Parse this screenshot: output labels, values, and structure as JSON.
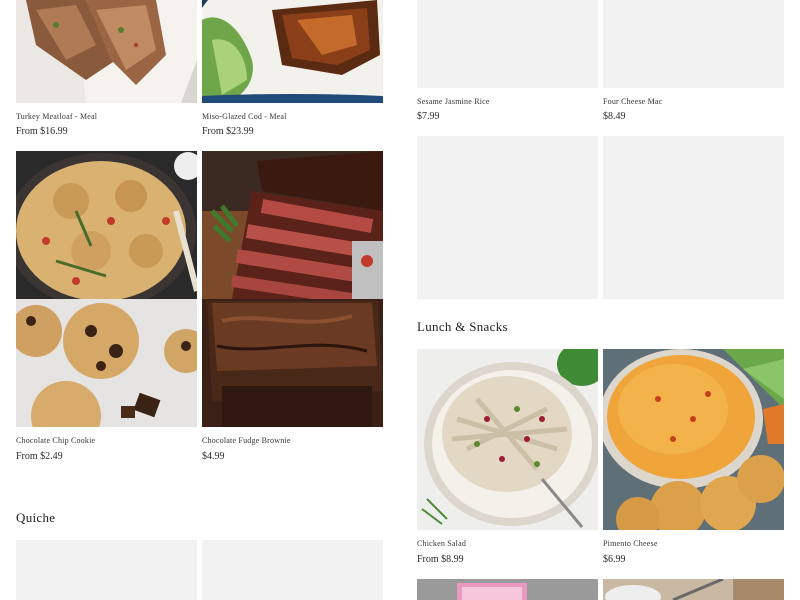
{
  "left_column": {
    "row1": [
      {
        "name": "Turkey Meatloaf - Meal",
        "price": "From $16.99",
        "image_icon": "turkey-meatloaf-image"
      },
      {
        "name": "Miso-Glazed Cod - Meal",
        "price": "From $23.99",
        "image_icon": "miso-glazed-cod-image"
      }
    ],
    "row2": [
      {
        "name": "Chocolate Chip Cookie",
        "price": "From $2.49",
        "image_icon": "chocolate-chip-cookie-image"
      },
      {
        "name": "Chocolate Fudge Brownie",
        "price": "$4.99",
        "image_icon": "chocolate-fudge-brownie-image"
      }
    ],
    "quiche_section": {
      "title": "Quiche"
    }
  },
  "right_column": {
    "row1": [
      {
        "name": "Sesame Jasmine Rice",
        "price": "$7.99"
      },
      {
        "name": "Four Cheese Mac",
        "price": "$8.49"
      }
    ],
    "lunch_section": {
      "title": "Lunch & Snacks"
    },
    "lunch_row": [
      {
        "name": "Chicken Salad",
        "price": "From $8.99",
        "image_icon": "chicken-salad-image"
      },
      {
        "name": "Pimento Cheese",
        "price": "$6.99",
        "image_icon": "pimento-cheese-image"
      }
    ]
  },
  "colors": {
    "placeholder": "#f2f2f2",
    "text": "#1f1f1f",
    "background": "#ffffff"
  }
}
